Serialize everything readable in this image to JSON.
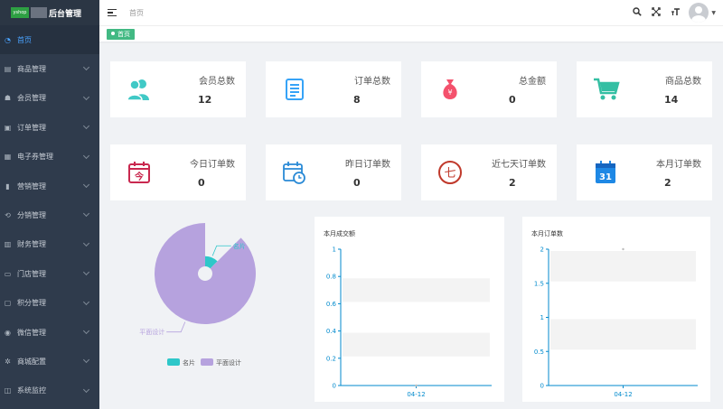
{
  "brand": {
    "logo_text": "yshop",
    "title": "后台管理"
  },
  "sidebar": {
    "items": [
      {
        "label": "首页",
        "icon": "dashboard-icon"
      },
      {
        "label": "商品管理",
        "icon": "goods-icon"
      },
      {
        "label": "会员管理",
        "icon": "members-icon"
      },
      {
        "label": "订单管理",
        "icon": "orders-icon"
      },
      {
        "label": "电子券管理",
        "icon": "coupon-icon"
      },
      {
        "label": "营销管理",
        "icon": "marketing-icon"
      },
      {
        "label": "分销管理",
        "icon": "distribution-icon"
      },
      {
        "label": "财务管理",
        "icon": "finance-icon"
      },
      {
        "label": "门店管理",
        "icon": "store-icon"
      },
      {
        "label": "积分管理",
        "icon": "points-icon"
      },
      {
        "label": "微信管理",
        "icon": "wechat-icon"
      },
      {
        "label": "商城配置",
        "icon": "settings-icon"
      },
      {
        "label": "系统监控",
        "icon": "monitor-icon"
      }
    ]
  },
  "header": {
    "breadcrumb": "首页",
    "icons": [
      "search-icon",
      "fullscreen-icon",
      "font-size-icon",
      "user-avatar"
    ]
  },
  "tags": {
    "active": "首页"
  },
  "stats_row1": [
    {
      "label": "会员总数",
      "value": "12",
      "icon": "members-icon",
      "color": "#40c9c6"
    },
    {
      "label": "订单总数",
      "value": "8",
      "icon": "document-icon",
      "color": "#36a3f7"
    },
    {
      "label": "总金额",
      "value": "0",
      "icon": "money-bag-icon",
      "color": "#f4516c"
    },
    {
      "label": "商品总数",
      "value": "14",
      "icon": "shopping-cart-icon",
      "color": "#34bfa3"
    }
  ],
  "stats_row2": [
    {
      "label": "今日订单数",
      "value": "0",
      "icon": "calendar-today-icon",
      "color": "#c9284f",
      "glyph": "今"
    },
    {
      "label": "昨日订单数",
      "value": "0",
      "icon": "calendar-clock-icon",
      "color": "#2a8ad6"
    },
    {
      "label": "近七天订单数",
      "value": "2",
      "icon": "seven-circle-icon",
      "color": "#c0392b",
      "glyph": "七"
    },
    {
      "label": "本月订单数",
      "value": "2",
      "icon": "calendar-31-icon",
      "color": "#1e88e5",
      "glyph": "31"
    }
  ],
  "chart_data": [
    {
      "type": "pie",
      "categories": [
        "名片",
        "平面设计"
      ],
      "values": [
        1,
        7
      ],
      "colors": [
        "#2ec7c9",
        "#b6a2de"
      ],
      "legend": [
        "名片",
        "平面设计"
      ],
      "legend_position": "bottom"
    },
    {
      "type": "line",
      "title": "本月成交额",
      "x": [
        "04-12"
      ],
      "series": [
        {
          "values": [
            0
          ]
        }
      ],
      "ylim": [
        0,
        1
      ],
      "yticks": [
        "0",
        "0.2",
        "0.4",
        "0.6",
        "0.8",
        "1"
      ],
      "grid": "striped"
    },
    {
      "type": "line",
      "title": "本月订单数",
      "x": [
        "04-12"
      ],
      "series": [
        {
          "values": [
            2
          ]
        }
      ],
      "ylim": [
        0,
        2
      ],
      "yticks": [
        "0",
        "0.5",
        "1",
        "1.5",
        "2"
      ],
      "grid": "striped"
    }
  ]
}
